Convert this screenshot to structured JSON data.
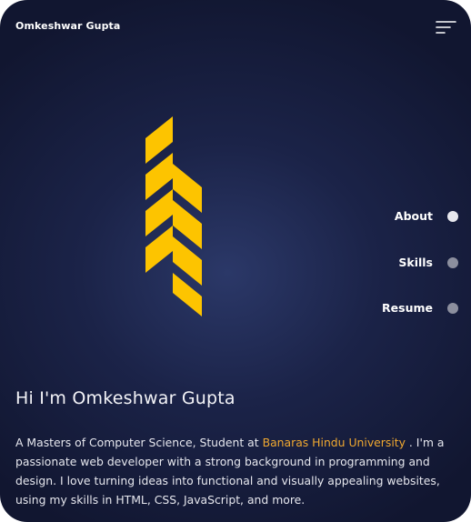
{
  "header": {
    "brand": "Omkeshwar Gupta",
    "menu_icon": "hamburger-menu-icon"
  },
  "logo": {
    "icon": "chevron-stripes-logo",
    "color": "#fdc400"
  },
  "nav": {
    "items": [
      {
        "label": "About",
        "active": true
      },
      {
        "label": "Skills",
        "active": false
      },
      {
        "label": "Resume",
        "active": false
      }
    ]
  },
  "hero": {
    "title": "Hi I'm Omkeshwar Gupta",
    "text_before": "A Masters of Computer Science, Student at ",
    "university": "Banaras Hindu University",
    "text_after": " . I'm a passionate web developer with a strong background in programming and design. I love turning ideas into functional and visually appealing websites, using my skills in HTML, CSS, JavaScript, and more."
  },
  "colors": {
    "background": "#1b2348",
    "accent": "#fdc400",
    "link": "#f0a830"
  }
}
